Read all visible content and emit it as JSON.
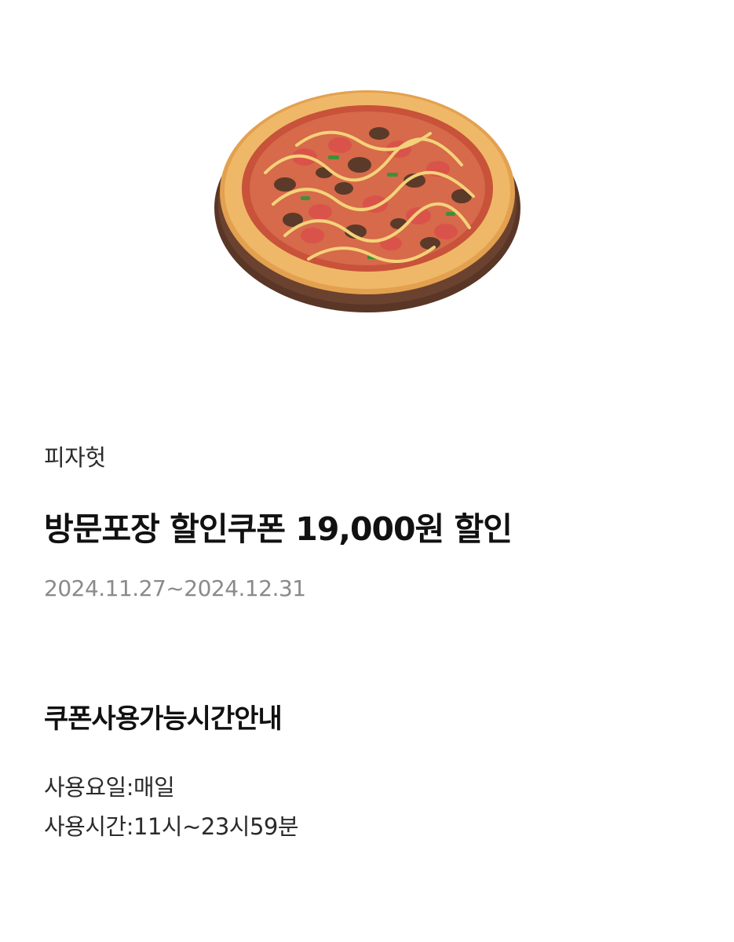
{
  "coupon": {
    "brand": "피자헛",
    "title": "방문포장 할인쿠폰 19,000원 할인",
    "period": "2024.11.27~2024.12.31",
    "image_icon": "pizza-image"
  },
  "usage_info": {
    "section_title": "쿠폰사용가능시간안내",
    "days": "사용요일:매일",
    "hours": "사용시간:11시~23시59분"
  }
}
